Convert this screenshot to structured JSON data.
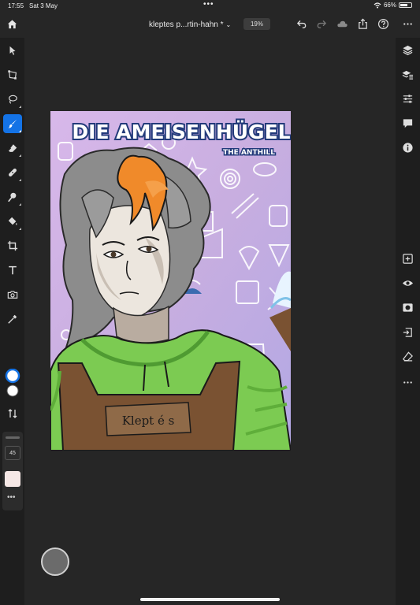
{
  "status_bar": {
    "time": "17:55",
    "date": "Sat 3 May",
    "dots": "•••",
    "battery": "66%",
    "battery_level": 0.66
  },
  "top_bar": {
    "document_name": "kleptes p...rtin-hahn *",
    "zoom": "19%",
    "icons": [
      "home-icon",
      "undo-icon",
      "redo-icon",
      "cloud-icon",
      "share-icon",
      "help-icon",
      "more-icon"
    ]
  },
  "left_toolbar": {
    "tools": [
      "select-icon",
      "transform-icon",
      "lasso-icon",
      "brush-icon",
      "eraser-icon",
      "healing-icon",
      "smudge-icon",
      "fill-icon",
      "crop-icon",
      "text-icon",
      "camera-icon",
      "eyedropper-icon"
    ],
    "active_tool": "brush-icon",
    "brush_size": "45",
    "more": "•••"
  },
  "right_toolbar": {
    "icons": [
      "layers-icon",
      "layer-properties-icon",
      "adjustments-icon",
      "comments-icon",
      "info-icon",
      "add-layer-icon",
      "visibility-icon",
      "mask-icon",
      "import-icon",
      "clear-icon",
      "more-icon"
    ]
  },
  "artwork": {
    "title": "DIE AMEISENHÜGEL",
    "subtitle": "THE ANTHILL",
    "apron_label": "Klept é s"
  },
  "colors": {
    "accent": "#1473e6",
    "toolbar_bg": "#1e1e1e",
    "workspace_bg": "#262626",
    "hair_orange": "#f08a2a",
    "hoodie_green": "#7ccb52",
    "apron_brown": "#7a5232",
    "background_lilac": "#c8aee0",
    "title_navy": "#223a7a"
  }
}
